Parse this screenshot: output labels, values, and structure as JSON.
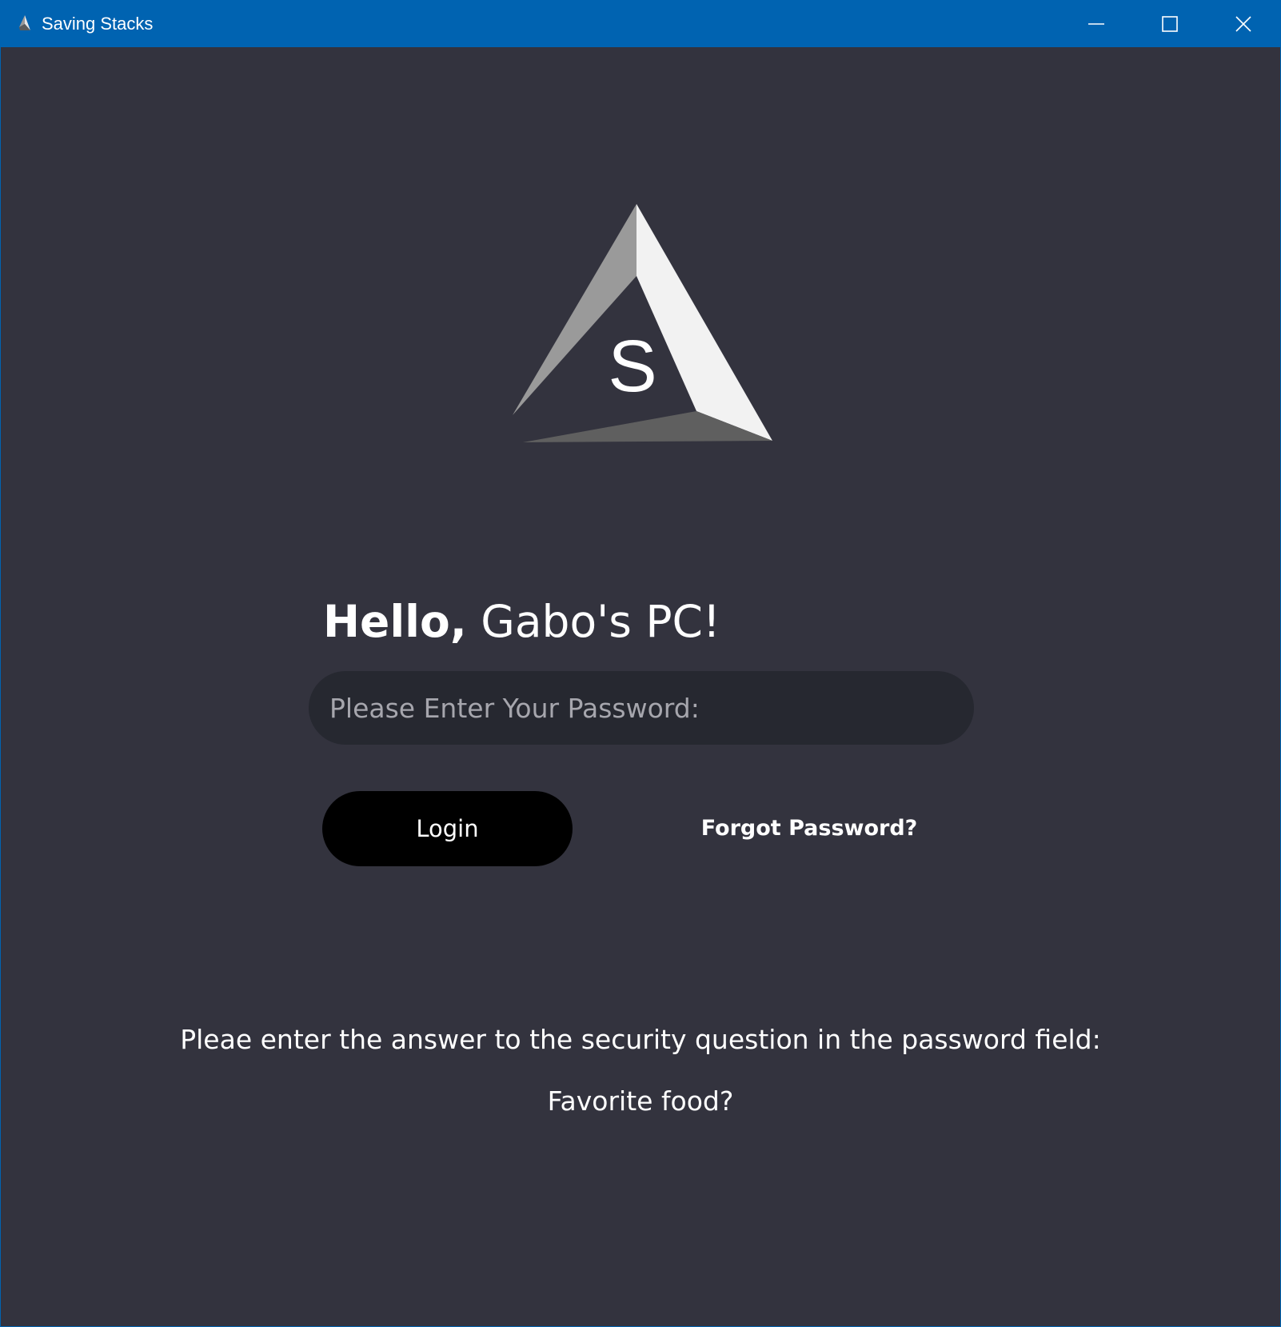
{
  "window": {
    "title": "Saving Stacks",
    "accent_color": "#0063b1",
    "background_color": "#33333e"
  },
  "window_controls": {
    "minimize_icon": "minimize-icon",
    "maximize_icon": "maximize-icon",
    "close_icon": "close-icon"
  },
  "logo": {
    "letter": "S"
  },
  "greeting": {
    "hello": "Hello,",
    "name": "Gabo's PC!"
  },
  "password": {
    "placeholder": "Please Enter Your Password:",
    "value": ""
  },
  "actions": {
    "login_label": "Login",
    "forgot_label": "Forgot Password?"
  },
  "security": {
    "hint": "Pleae enter the answer to the security question in the password field:",
    "question": "Favorite food?"
  }
}
